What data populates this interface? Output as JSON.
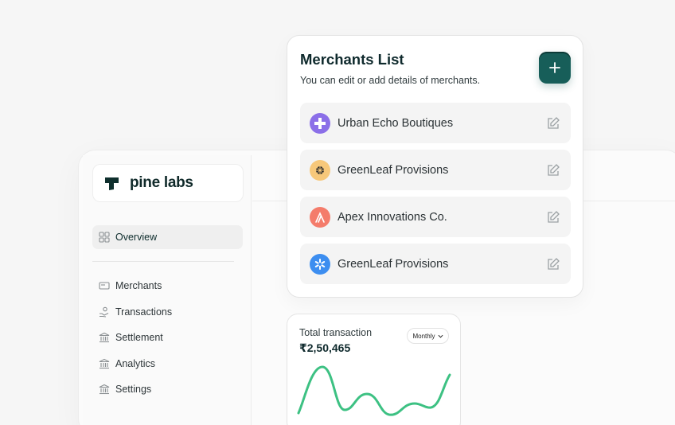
{
  "brand": {
    "name": "pine labs",
    "logo_icon": "pine-labs-logo"
  },
  "sidebar": {
    "items": [
      {
        "label": "Overview",
        "icon": "grid-icon",
        "active": true
      },
      {
        "label": "Merchants",
        "icon": "card-icon"
      },
      {
        "label": "Transactions",
        "icon": "hand-coins-icon"
      },
      {
        "label": "Settlement",
        "icon": "bank-icon"
      },
      {
        "label": "Analytics",
        "icon": "bank-icon"
      },
      {
        "label": "Settings",
        "icon": "bank-icon"
      }
    ]
  },
  "merchants": {
    "title": "Merchants List",
    "subtitle": "You can edit or add details of merchants.",
    "add_icon": "plus-icon",
    "items": [
      {
        "name": "Urban Echo Boutiques",
        "avatar_color": "#8b6fe8",
        "avatar_icon": "cross-flower-icon"
      },
      {
        "name": "GreenLeaf Provisions",
        "avatar_color": "#f7c87a",
        "avatar_icon": "leaf-grid-icon"
      },
      {
        "name": "Apex Innovations Co.",
        "avatar_color": "#f47c6b",
        "avatar_icon": "apex-icon"
      },
      {
        "name": "GreenLeaf Provisions",
        "avatar_color": "#3d8ef0",
        "avatar_icon": "snowflake-icon"
      }
    ],
    "edit_icon": "edit-icon"
  },
  "transaction": {
    "label": "Total transaction",
    "value": "₹2,50,465",
    "period": "Monthly",
    "line_color": "#3dc183"
  },
  "colors": {
    "accent": "#175e59"
  }
}
